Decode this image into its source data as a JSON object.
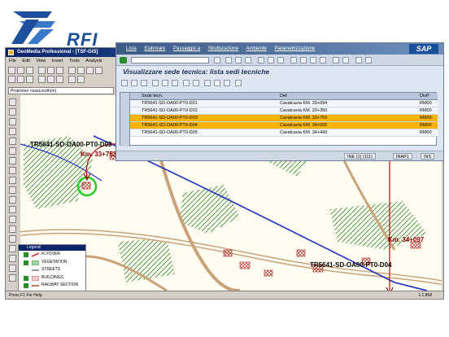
{
  "logo": {
    "text": "RFI"
  },
  "geomedia": {
    "title": "GeoMedia Professional - [TSF-GIS]",
    "menu": [
      "File",
      "Edit",
      "View",
      "Insert",
      "Tools",
      "Analysis"
    ],
    "projection": "Projection <east,north(m)",
    "status_left": "Press F1 For Help.",
    "status_right": "1:1,868"
  },
  "map": {
    "features": [
      {
        "id": "TR5641-SD-OA00-PT0-D03",
        "km": "Km. 33+753"
      },
      {
        "id": "TR5641-SD-OA00-PT0-D04",
        "km": "Km. 34+097"
      }
    ]
  },
  "legend": {
    "title": "Legend",
    "items": [
      {
        "label": "FLYOVER",
        "color": "#d22020"
      },
      {
        "label": "VEGETATION",
        "color": "#2a8a2a"
      },
      {
        "label": "STREETS",
        "color": "#555555"
      },
      {
        "label": "BUILDINGS",
        "color": "#b03030"
      },
      {
        "label": "RAILWAY SECTION",
        "color": "#a0522d"
      }
    ]
  },
  "sap": {
    "menu": [
      "Lista",
      "Elaborare",
      "Passaggio a",
      "Strutturazione",
      "Ambiente",
      "Parametrizzazione"
    ],
    "logo": "SAP",
    "title": "Visualizzare sede tecnica: lista sedi tecniche",
    "columns": [
      "Sede tecn.",
      "Def.",
      "DivP."
    ],
    "rows": [
      {
        "sede": "TR5641-SD-OA00-PT0-D01",
        "def": "Cavalcavia  KM. 29+094",
        "divp": "RM00",
        "highlight": false
      },
      {
        "sede": "TR5641-SD-OA00-PT0-D02",
        "def": "Cavalcavia  KM. 29+350",
        "divp": "RM00",
        "highlight": false
      },
      {
        "sede": "TR5641-SD-OA00-PT0-D03",
        "def": "Cavalcavia  KM. 33+753",
        "divp": "RM00",
        "highlight": true
      },
      {
        "sede": "TR5641-SD-OA00-PT0-D04",
        "def": "Cavalcavia  KM. 34+092",
        "divp": "RM00",
        "highlight": true
      },
      {
        "sede": "TR5641-SD-OA00-PT0-D05",
        "def": "Cavalcavia  KM. 34+443",
        "divp": "RM00",
        "highlight": false
      }
    ],
    "status": [
      "INE (1) (111)",
      "INAP1",
      "INS"
    ]
  }
}
